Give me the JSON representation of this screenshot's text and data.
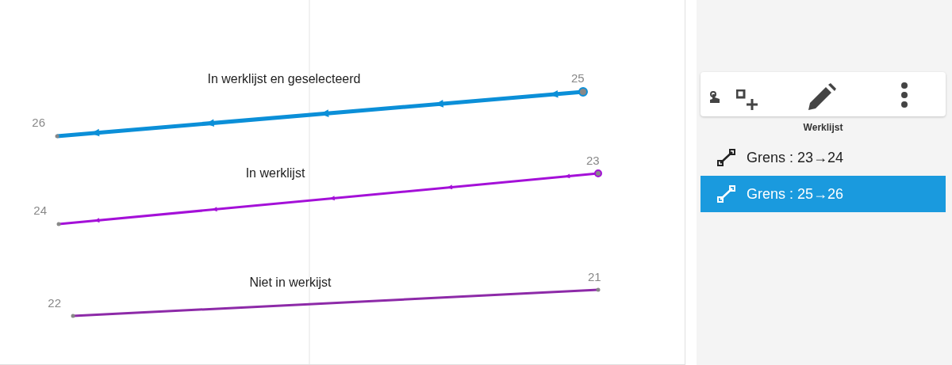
{
  "canvas": {
    "segments": [
      {
        "kind": "selected",
        "label": "In werklijst en geselecteerd",
        "start": "25",
        "end": "26"
      },
      {
        "kind": "worklist",
        "label": "In werklijst",
        "start": "23",
        "end": "24"
      },
      {
        "kind": "plain",
        "label": "Niet in werkijst",
        "start": "21",
        "end": "22"
      }
    ]
  },
  "panel": {
    "title": "Werklijst",
    "items": [
      {
        "label": "Grens : 23→24",
        "selected": false
      },
      {
        "label": "Grens : 25→26",
        "selected": true
      }
    ]
  }
}
